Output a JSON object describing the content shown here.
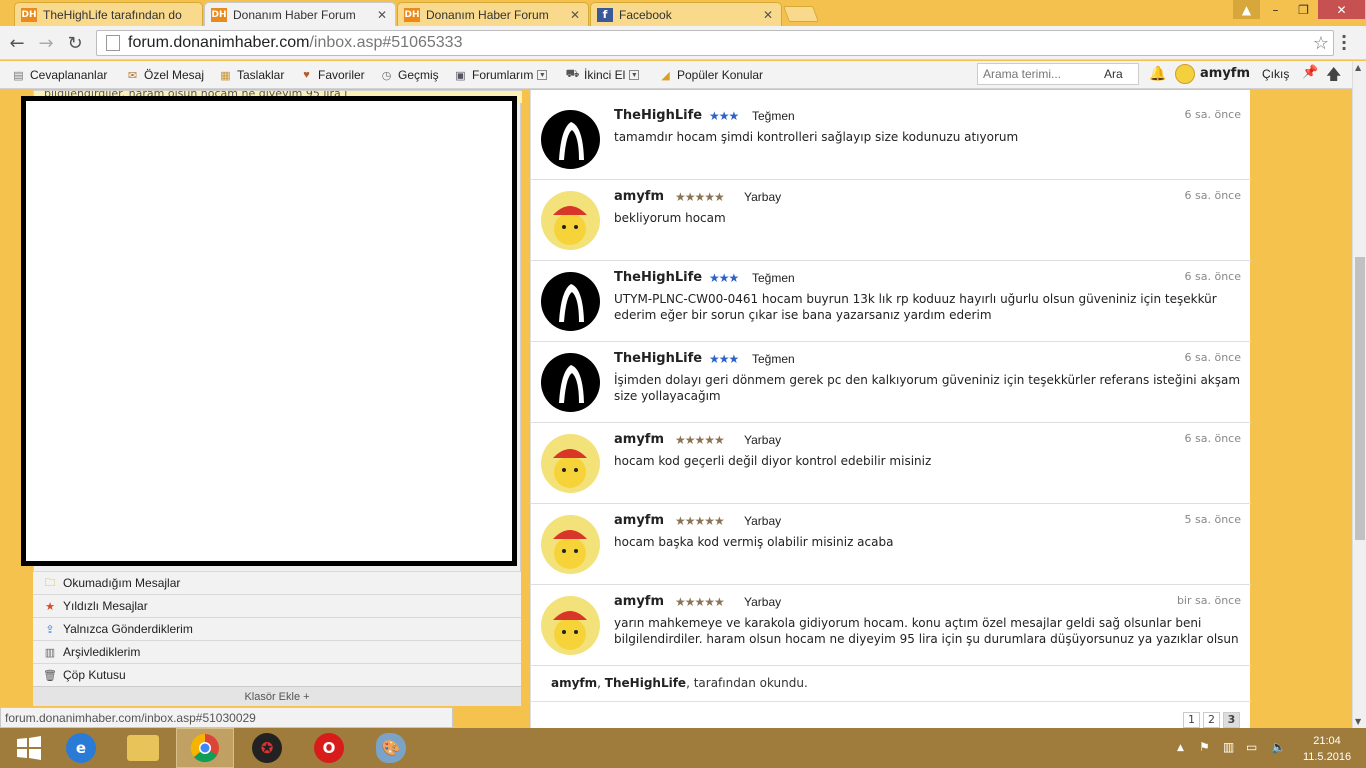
{
  "browser": {
    "tabs": [
      {
        "title": "TheHighLife tarafından do",
        "favicon": "DH",
        "active": false
      },
      {
        "title": "Donanım Haber Forum",
        "favicon": "DH",
        "active": true
      },
      {
        "title": "Donanım Haber Forum",
        "favicon": "DH",
        "active": false
      },
      {
        "title": "Facebook",
        "favicon": "f",
        "active": false
      }
    ],
    "url_host": "forum.donanimhaber.com",
    "url_path": "/inbox.asp#51065333"
  },
  "sitenav": {
    "items": [
      {
        "label": "Cevaplananlar",
        "icon": "reply-icon"
      },
      {
        "label": "Özel Mesaj",
        "icon": "envelope-icon"
      },
      {
        "label": "Taslaklar",
        "icon": "drafts-icon"
      },
      {
        "label": "Favoriler",
        "icon": "favorites-icon"
      },
      {
        "label": "Geçmiş",
        "icon": "history-icon"
      },
      {
        "label": "Forumlarım",
        "icon": "forums-icon"
      },
      {
        "label": "İkinci El",
        "icon": "cart-icon"
      },
      {
        "label": "Popüler Konular",
        "icon": "popular-icon"
      }
    ],
    "search_placeholder": "Arama terimi...",
    "search_button": "Ara",
    "username": "amyfm",
    "logout": "Çıkış"
  },
  "sidebar": {
    "top_snippet": "bilgilendirdiler. haram olsun hocam ne diyeyim 95 lira i",
    "folders": [
      {
        "label": "Okumadığım Mesajlar"
      },
      {
        "label": "Yıldızlı Mesajlar"
      },
      {
        "label": "Yalnızca Gönderdiklerim"
      },
      {
        "label": "Arşivlediklerim"
      },
      {
        "label": "Çöp Kutusu"
      }
    ],
    "add_folder": "Klasör Ekle +"
  },
  "messages": [
    {
      "author": "TheHighLife",
      "rank": "Teğmen",
      "stars": "★★★",
      "time": "6 sa. önce",
      "text": "tamamdır hocam şimdi kontrolleri sağlayıp size kodunuzu atıyorum"
    },
    {
      "author": "amyfm",
      "rank": "Yarbay",
      "stars": "★★★★★",
      "time": "6 sa. önce",
      "text": "bekliyorum hocam"
    },
    {
      "author": "TheHighLife",
      "rank": "Teğmen",
      "stars": "★★★",
      "time": "6 sa. önce",
      "text": "UTYM-PLNC-CW00-0461 hocam buyrun 13k lık rp koduuz hayırlı uğurlu olsun güveniniz için teşekkür ederim eğer bir sorun çıkar ise bana yazarsanız yardım ederim"
    },
    {
      "author": "TheHighLife",
      "rank": "Teğmen",
      "stars": "★★★",
      "time": "6 sa. önce",
      "text": "İşimden dolayı geri dönmem gerek pc den kalkıyorum güveniniz için teşekkürler referans isteğini akşam size yollayacağım"
    },
    {
      "author": "amyfm",
      "rank": "Yarbay",
      "stars": "★★★★★",
      "time": "6 sa. önce",
      "text": "hocam kod geçerli değil diyor kontrol edebilir misiniz"
    },
    {
      "author": "amyfm",
      "rank": "Yarbay",
      "stars": "★★★★★",
      "time": "5 sa. önce",
      "text": "hocam başka kod vermiş olabilir misiniz acaba"
    },
    {
      "author": "amyfm",
      "rank": "Yarbay",
      "stars": "★★★★★",
      "time": "bir sa. önce",
      "text": "yarın mahkemeye ve karakola gidiyorum hocam. konu açtım özel mesajlar geldi sağ olsunlar beni bilgilendirdiler. haram olsun hocam ne diyeyim 95 lira için şu durumlara düşüyorsunuz ya yazıklar olsun"
    }
  ],
  "readby": {
    "user1": "amyfm",
    "sep": ", ",
    "user2": "TheHighLife",
    "suffix": ", tarafından okundu."
  },
  "pager": [
    "1",
    "2",
    "3"
  ],
  "pager_current": "3",
  "statusbar": "forum.donanimhaber.com/inbox.asp#51030029",
  "clock": {
    "time": "21:04",
    "date": "11.5.2016"
  }
}
